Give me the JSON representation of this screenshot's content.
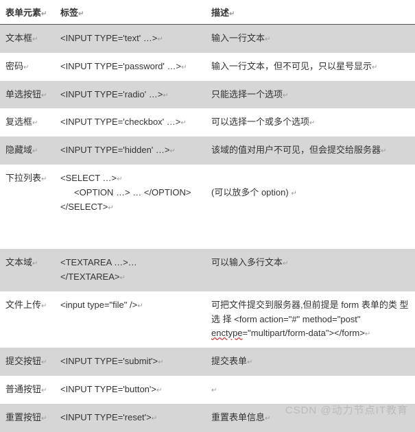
{
  "headers": {
    "col1": "表单元素",
    "col2": "标签",
    "col3": "描述"
  },
  "marker": "↵",
  "rows": [
    {
      "name": "文本框",
      "tag": "<INPUT TYPE='text' …>",
      "desc": "输入一行文本"
    },
    {
      "name": "密码",
      "tag": "<INPUT TYPE='password' …>",
      "desc": "输入一行文本，但不可见，只以星号显示"
    },
    {
      "name": "单选按钮",
      "tag": "<INPUT TYPE='radio' …>",
      "desc": "只能选择一个选项"
    },
    {
      "name": "复选框",
      "tag": "<INPUT TYPE='checkbox' …>",
      "desc": "可以选择一个或多个选项"
    },
    {
      "name": "隐藏域",
      "tag": "<INPUT TYPE='hidden' …>",
      "desc": "该域的值对用户不可见，但会提交给服务器"
    }
  ],
  "select_row": {
    "name": "下拉列表",
    "line1": "<SELECT …>",
    "line2": "<OPTION …> … </OPTION>",
    "line3": "</SELECT>",
    "desc": "(可以放多个 option)  "
  },
  "rows2": [
    {
      "name": "文本域",
      "tag": "<TEXTAREA …>…</TEXTAREA>",
      "desc": "可以输入多行文本"
    }
  ],
  "file_row": {
    "name": "文件上传",
    "tag": "<input type=\"file\" />",
    "desc_pre": "可把文件提交到服务器,但前提是 form 表单的类 型 选 择 <form  action=\"#\"  method=\"post\" ",
    "desc_red": "enctype",
    "desc_post": "=\"multipart/form-data\"></form>"
  },
  "rows3": [
    {
      "name": "提交按钮",
      "tag": "<INPUT TYPE='submit'>",
      "desc": "提交表单"
    },
    {
      "name": "普通按钮",
      "tag": "<INPUT TYPE='button'>",
      "desc": ""
    },
    {
      "name": "重置按钮",
      "tag": "<INPUT TYPE='reset'>",
      "desc": "重置表单信息"
    }
  ],
  "watermark": "CSDN @动力节点IT教育"
}
